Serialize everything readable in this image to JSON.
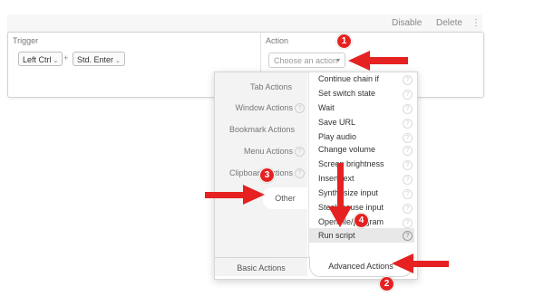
{
  "toolbar": {
    "disable": "Disable",
    "delete": "Delete",
    "more": "⋮"
  },
  "trigger": {
    "label": "Trigger",
    "key1": "Left Ctrl",
    "plus": "+",
    "key2": "Std. Enter",
    "caret": "⌄"
  },
  "action": {
    "label": "Action",
    "select_text": "Choose an action",
    "select_caret": "▾"
  },
  "popup": {
    "categories": [
      "Tab Actions",
      "Window Actions",
      "Bookmark Actions",
      "Menu Actions",
      "Clipboard Actions",
      "Other"
    ],
    "help_glyph": "?",
    "items": [
      "Continue chain if",
      "Set switch state",
      "Wait",
      "Save URL",
      "Play audio",
      "Change volume",
      "Screen brightness",
      "Insert text",
      "Synthesize input",
      "Steal mouse input",
      "Open file/program",
      "Run script"
    ],
    "selected_item": "Run script",
    "tab_basic": "Basic Actions",
    "tab_advanced": "Advanced Actions"
  },
  "annotations": {
    "badges": [
      "1",
      "2",
      "3",
      "4"
    ],
    "arrow_color": "#e52121"
  }
}
